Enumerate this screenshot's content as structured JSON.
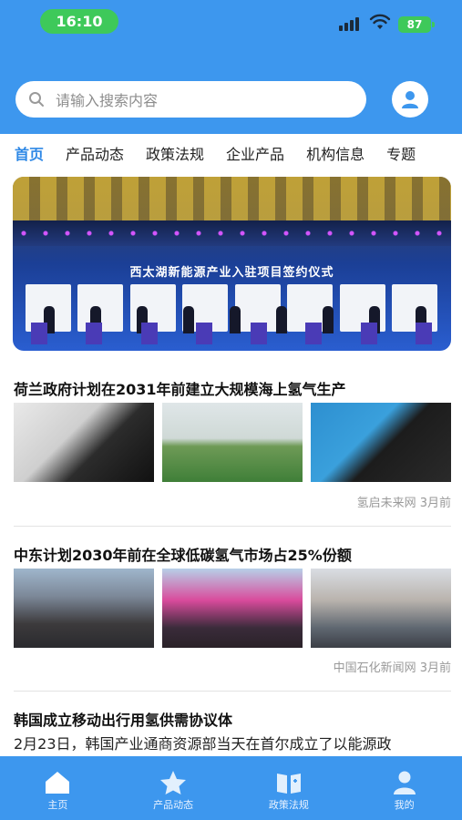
{
  "status_bar": {
    "time": "16:10",
    "battery": "87"
  },
  "search": {
    "placeholder": "请输入搜索内容"
  },
  "tabs": [
    {
      "label": "首页",
      "active": true
    },
    {
      "label": "产品动态"
    },
    {
      "label": "政策法规"
    },
    {
      "label": "企业产品"
    },
    {
      "label": "机构信息"
    },
    {
      "label": "专题"
    }
  ],
  "banner": {
    "caption": "西太湖新能源产业入驻项目签约仪式"
  },
  "news": [
    {
      "title": "荷兰政府计划在2031年前建立大规模海上氢气生产",
      "source": "氢启未来网",
      "time": "3月前"
    },
    {
      "title": "中东计划2030年前在全球低碳氢气市场占25%份额",
      "source": "中国石化新闻网",
      "time": "3月前"
    },
    {
      "title": "韩国成立移动出行用氢供需协议体",
      "excerpt": "2月23日，韩国产业通商资源部当天在首尔成立了以能源政"
    }
  ],
  "bottom_nav": [
    {
      "label": "主页",
      "icon": "home-icon"
    },
    {
      "label": "产品动态",
      "icon": "star-icon"
    },
    {
      "label": "政策法规",
      "icon": "book-icon"
    },
    {
      "label": "我的",
      "icon": "user-icon"
    }
  ],
  "colors": {
    "primary": "#3d97ee",
    "active_tab": "#2e88e6",
    "pill_green": "#3ec95a"
  }
}
